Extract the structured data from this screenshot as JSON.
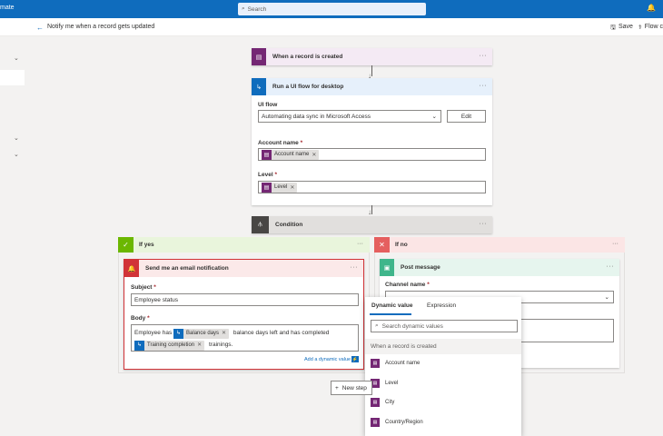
{
  "app": {
    "brand": "mate"
  },
  "topbar": {
    "search_placeholder": "Search"
  },
  "cmdbar": {
    "flow_title": "Notify me when a record gets updated",
    "save_label": "Save",
    "checker_label": "Flow c"
  },
  "trigger": {
    "label": "When a record is created",
    "color": "#742774"
  },
  "uiflow": {
    "label": "Run a UI flow for desktop",
    "color": "#0f6cbd",
    "uiflow_label": "UI flow",
    "uiflow_value": "Automating data sync in Microsoft Access",
    "edit_label": "Edit",
    "account_label": "Account name",
    "account_token": "Account name",
    "level_label": "Level",
    "level_token": "Level"
  },
  "condition": {
    "label": "Condition"
  },
  "if_yes": {
    "label": "If yes",
    "color": "#6bb700"
  },
  "if_no": {
    "label": "If no",
    "color": "#e55f5f"
  },
  "email": {
    "label": "Send me an email notification",
    "subject_label": "Subject",
    "subject_value": "Employee status",
    "body_label": "Body",
    "body_text1": "Employee has",
    "token_balance": "Balance days",
    "body_text2": "balance days left and has completed",
    "token_training": "Training completion",
    "body_text3": "trainings.",
    "add_dynamic": "Add a dynamic value"
  },
  "post": {
    "label": "Post message",
    "channel_label": "Channel name"
  },
  "dynamic": {
    "tab_dynamic": "Dynamic value",
    "tab_expression": "Expression",
    "search_placeholder": "Search dynamic values",
    "section": "When a record is created",
    "items": [
      "Account name",
      "Level",
      "City",
      "Country/Region"
    ]
  },
  "new_step": "New step"
}
